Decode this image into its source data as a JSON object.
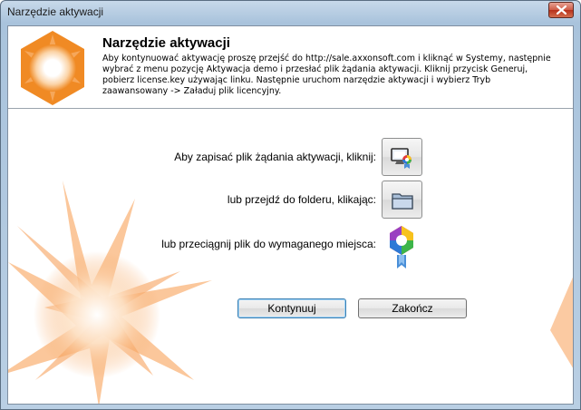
{
  "window": {
    "title": "Narzędzie aktywacji",
    "close_icon": "close-icon"
  },
  "header": {
    "title": "Narzędzie aktywacji",
    "description": "Aby kontynuować aktywację proszę przejść do http://sale.axxonsoft.com i kliknąć w Systemy, następnie wybrać z menu pozycję Aktywacja demo i przesłać plik żądania aktywacji. Kliknij przycisk Generuj, pobierz license.key używając linku. Następnie uruchom narzędzie aktywacji i wybierz Tryb zaawansowany -> Załaduj plik licencyjny.",
    "logo_icon": "product-logo-icon"
  },
  "actions": {
    "save_request_label": "Aby zapisać plik żądania aktywacji, kliknij:",
    "open_folder_label": "lub przejdź do folderu, klikając:",
    "drag_file_label": "lub przeciągnij plik do wymaganego miejsca:",
    "save_request_icon": "save-request-icon",
    "open_folder_icon": "folder-icon",
    "drag_file_icon": "activation-file-icon"
  },
  "footer": {
    "continue_label": "Kontynuuj",
    "finish_label": "Zakończ"
  },
  "colors": {
    "accent_orange": "#f08a24",
    "primary_button_border": "#3c7fb1",
    "title_bar": "#b9cfe4"
  }
}
